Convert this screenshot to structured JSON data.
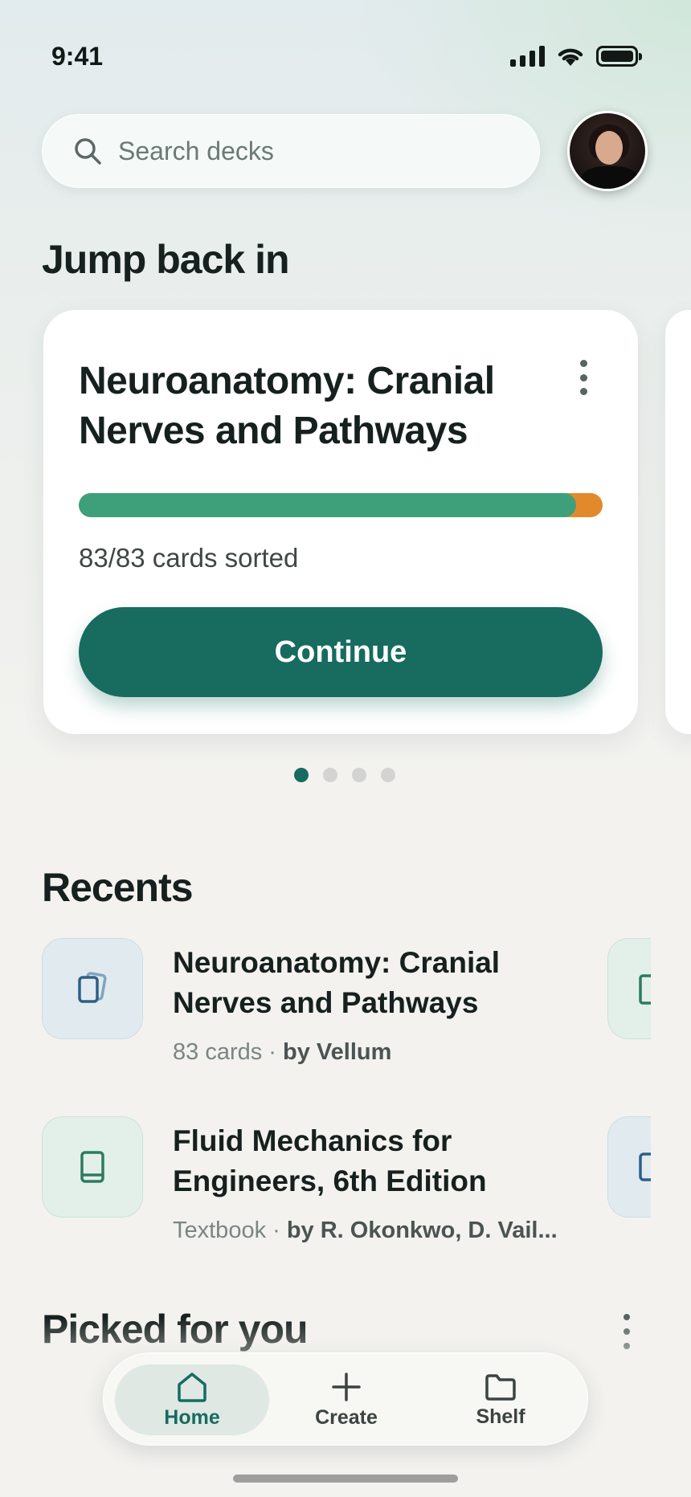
{
  "status_bar": {
    "time": "9:41"
  },
  "search": {
    "placeholder": "Search decks"
  },
  "jump_back": {
    "heading": "Jump back in",
    "card": {
      "title": "Neuroanatomy: Cranial Nerves and Pathways",
      "progress_fraction": 0.95,
      "count_text": "83/83 cards sorted",
      "button_label": "Continue"
    },
    "page_count": 4,
    "active_page": 1
  },
  "recents": {
    "heading": "Recents",
    "items": [
      {
        "title": "Neuroanatomy: Cranial Nerves and Pathways",
        "meta_left": "83 cards · ",
        "meta_author": "by Vellum",
        "icon": "flashcards-icon",
        "color": "#e1ebef"
      },
      {
        "title": "Fluid Mechanics for Engineers, 6th Edition",
        "meta_left": "Textbook · ",
        "meta_author": "by R. Okonkwo, D. Vail...",
        "icon": "book-icon",
        "color": "#e3f0ea"
      }
    ]
  },
  "picked": {
    "heading": "Picked for you"
  },
  "tab_bar": {
    "tabs": [
      {
        "label": "Home",
        "icon": "home-icon",
        "active": true
      },
      {
        "label": "Create",
        "icon": "plus-icon",
        "active": false
      },
      {
        "label": "Shelf",
        "icon": "folder-icon",
        "active": false
      }
    ]
  },
  "colors": {
    "accent": "#176b5f",
    "progress_done": "#3ea07a",
    "progress_rest": "#e28a2b"
  }
}
